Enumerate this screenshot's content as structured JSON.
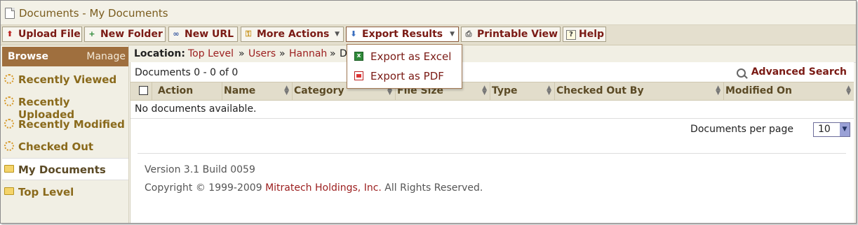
{
  "window": {
    "title": "Documents - My Documents"
  },
  "toolbar": {
    "upload": "Upload File",
    "new_folder": "New Folder",
    "new_url": "New URL",
    "more_actions": "More Actions",
    "export_results": "Export Results",
    "printable_view": "Printable View",
    "help": "Help"
  },
  "export_menu": {
    "excel": "Export as Excel",
    "pdf": "Export as PDF"
  },
  "sidebar": {
    "browse": "Browse",
    "manage": "Manage",
    "items": [
      {
        "label": "Recently Viewed",
        "icon": "clock-icon"
      },
      {
        "label": "Recently Uploaded",
        "icon": "clock-icon"
      },
      {
        "label": "Recently Modified",
        "icon": "clock-icon"
      },
      {
        "label": "Checked Out",
        "icon": "clock-icon"
      },
      {
        "label": "My Documents",
        "icon": "folder-icon",
        "selected": true
      },
      {
        "label": "Top Level",
        "icon": "folder-icon"
      }
    ]
  },
  "location": {
    "label": "Location:",
    "crumbs": [
      "Top Level",
      "Users",
      "Hannah"
    ],
    "separator": "»",
    "partial": "D"
  },
  "documents": {
    "count_text": "Documents 0 - 0 of 0",
    "advanced_search": "Advanced Search",
    "columns": [
      "Action",
      "Name",
      "Category",
      "File Size",
      "Type",
      "Checked Out By",
      "Modified On"
    ],
    "empty_text": "No documents available.",
    "per_page_label": "Documents per page",
    "per_page_value": "10"
  },
  "footer": {
    "version": "Version 3.1 Build 0059",
    "copyright_prefix": "Copyright © 1999-2009 ",
    "company": "Mitratech Holdings, Inc.",
    "copyright_suffix": " All Rights Reserved."
  },
  "colors": {
    "accent": "#9f6f3e",
    "link": "#9b1d1d",
    "header_bg": "#e2ddcb"
  }
}
